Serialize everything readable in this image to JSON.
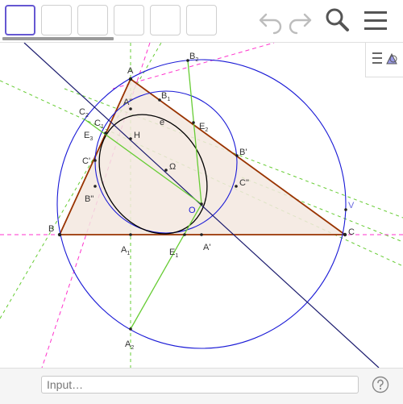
{
  "toolbar": {
    "tool_slots": [
      {
        "icon": "empty-tool-slot",
        "selected": true
      },
      {
        "icon": "empty-tool-slot",
        "selected": false
      },
      {
        "icon": "empty-tool-slot",
        "selected": false
      },
      {
        "icon": "empty-tool-slot",
        "selected": false
      },
      {
        "icon": "empty-tool-slot",
        "selected": false
      },
      {
        "icon": "empty-tool-slot",
        "selected": false
      }
    ],
    "undo_icon": "undo-icon",
    "redo_icon": "redo-icon",
    "search_icon": "search-icon",
    "menu_icon": "hamburger-menu-icon",
    "accent_color": "#6557d2"
  },
  "stylebar": {
    "icon": "style-bar-toggle-icon"
  },
  "graphics": {
    "colors": {
      "triangle_edge": "#993300",
      "triangle_fill": "#f3e7df",
      "circle": "#1a1ad6",
      "ellipse": "#000000",
      "euler_line": "#1b1b6e",
      "green_lines": "#66cc33",
      "magenta_lines": "#ff33cc"
    },
    "labels": {
      "A": "A",
      "B": "B",
      "C": "C",
      "A2p": "A\"",
      "B2p": "B\"",
      "C2p": "C\"",
      "Ap": "A'",
      "Bp": "B'",
      "Cp": "C'",
      "A1": "A",
      "A1_sub": "1",
      "A2": "A",
      "A2_sub": "2",
      "B1": "B",
      "B1_sub": "1",
      "B2": "B",
      "B2_sub": "2",
      "C1": "C",
      "C1_sub": "1",
      "C2": "C",
      "C2_sub": "2",
      "E1": "E",
      "E1_sub": "1",
      "E2": "E",
      "E2_sub": "2",
      "E3": "E",
      "E3_sub": "3",
      "H": "H",
      "Omega": "Ω",
      "O": "O",
      "V": "V",
      "e": "e"
    }
  },
  "inputbar": {
    "placeholder": "Input…",
    "help_icon": "help-icon"
  }
}
